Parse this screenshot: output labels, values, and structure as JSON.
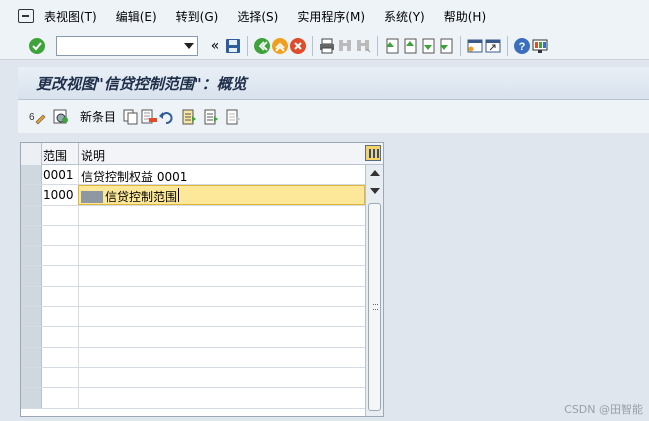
{
  "menu": {
    "items": [
      "表视图(T)",
      "编辑(E)",
      "转到(G)",
      "选择(S)",
      "实用程序(M)",
      "系统(Y)",
      "帮助(H)"
    ]
  },
  "toolbar": {
    "command_value": "",
    "icons": [
      "enter-icon",
      "save-icon",
      "back-icon",
      "exit-icon",
      "cancel-icon",
      "print-icon",
      "find-icon",
      "find-next-icon",
      "first-page-icon",
      "prev-page-icon",
      "next-page-icon",
      "last-page-icon",
      "new-session-icon",
      "shortcut-icon",
      "help-icon",
      "layout-icon"
    ]
  },
  "title": "更改视图\"信贷控制范围\"：概览",
  "app_toolbar": {
    "new_entries_label": "新条目"
  },
  "table": {
    "headers": {
      "key": "范围",
      "desc": "说明"
    },
    "rows": [
      {
        "key": "0001",
        "desc": "信贷控制权益 0001"
      },
      {
        "key": "1000",
        "desc": "信贷控制范围"
      }
    ]
  },
  "watermark": "CSDN @田智能",
  "colors": {
    "active_cell": "#fde89a",
    "title_text": "#1f2f4a"
  }
}
